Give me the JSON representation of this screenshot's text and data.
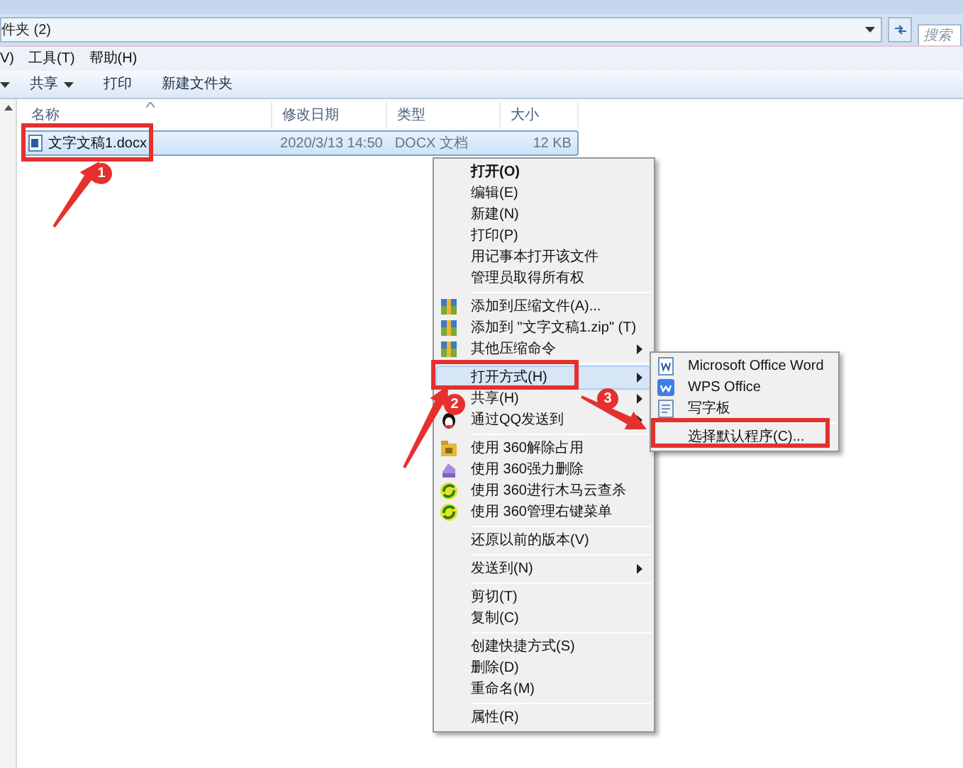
{
  "address_bar": {
    "path": "件夹 (2)",
    "search_placeholder": "搜索"
  },
  "menu_bar": [
    "V)",
    "工具(T)",
    "帮助(H)"
  ],
  "toolbar": [
    {
      "label": "共享",
      "dropdown": true
    },
    {
      "label": "打印",
      "dropdown": false
    },
    {
      "label": "新建文件夹",
      "dropdown": false
    }
  ],
  "columns": [
    {
      "label": "名称",
      "sorted": true
    },
    {
      "label": "修改日期",
      "sorted": false
    },
    {
      "label": "类型",
      "sorted": false
    },
    {
      "label": "大小",
      "sorted": false
    }
  ],
  "files": [
    {
      "name": "文字文稿1.docx",
      "modified": "2020/3/13 14:50",
      "type": "DOCX 文档",
      "size": "12 KB",
      "selected": true
    }
  ],
  "context_menu": {
    "items": [
      {
        "kind": "item",
        "label": "打开(O)",
        "default": true,
        "submenu": false,
        "selected": false
      },
      {
        "kind": "item",
        "label": "编辑(E)",
        "default": false,
        "submenu": false,
        "selected": false
      },
      {
        "kind": "item",
        "label": "新建(N)",
        "default": false,
        "submenu": false,
        "selected": false
      },
      {
        "kind": "item",
        "label": "打印(P)",
        "default": false,
        "submenu": false,
        "selected": false
      },
      {
        "kind": "item",
        "label": "用记事本打开该文件",
        "default": false,
        "submenu": false,
        "selected": false
      },
      {
        "kind": "item",
        "label": "管理员取得所有权",
        "default": false,
        "submenu": false,
        "selected": false
      },
      {
        "kind": "separator"
      },
      {
        "kind": "item",
        "label": "添加到压缩文件(A)...",
        "default": false,
        "submenu": false,
        "selected": false
      },
      {
        "kind": "item",
        "label": "添加到 \"文字文稿1.zip\" (T)",
        "default": false,
        "submenu": false,
        "selected": false
      },
      {
        "kind": "item",
        "label": "其他压缩命令",
        "default": false,
        "submenu": true,
        "selected": false
      },
      {
        "kind": "separator"
      },
      {
        "kind": "item",
        "label": "打开方式(H)",
        "default": false,
        "submenu": true,
        "selected": true
      },
      {
        "kind": "item",
        "label": "共享(H)",
        "default": false,
        "submenu": true,
        "selected": false
      },
      {
        "kind": "item",
        "label": "通过QQ发送到",
        "default": false,
        "submenu": true,
        "selected": false
      },
      {
        "kind": "separator"
      },
      {
        "kind": "item",
        "label": "使用 360解除占用",
        "default": false,
        "submenu": false,
        "selected": false
      },
      {
        "kind": "item",
        "label": "使用 360强力删除",
        "default": false,
        "submenu": false,
        "selected": false
      },
      {
        "kind": "item",
        "label": "使用 360进行木马云查杀",
        "default": false,
        "submenu": false,
        "selected": false
      },
      {
        "kind": "item",
        "label": "使用 360管理右键菜单",
        "default": false,
        "submenu": false,
        "selected": false
      },
      {
        "kind": "separator"
      },
      {
        "kind": "item",
        "label": "还原以前的版本(V)",
        "default": false,
        "submenu": false,
        "selected": false
      },
      {
        "kind": "separator"
      },
      {
        "kind": "item",
        "label": "发送到(N)",
        "default": false,
        "submenu": true,
        "selected": false
      },
      {
        "kind": "separator"
      },
      {
        "kind": "item",
        "label": "剪切(T)",
        "default": false,
        "submenu": false,
        "selected": false
      },
      {
        "kind": "item",
        "label": "复制(C)",
        "default": false,
        "submenu": false,
        "selected": false
      },
      {
        "kind": "separator"
      },
      {
        "kind": "item",
        "label": "创建快捷方式(S)",
        "default": false,
        "submenu": false,
        "selected": false
      },
      {
        "kind": "item",
        "label": "删除(D)",
        "default": false,
        "submenu": false,
        "selected": false
      },
      {
        "kind": "item",
        "label": "重命名(M)",
        "default": false,
        "submenu": false,
        "selected": false
      },
      {
        "kind": "separator"
      },
      {
        "kind": "item",
        "label": "属性(R)",
        "default": false,
        "submenu": false,
        "selected": false
      }
    ]
  },
  "open_with_submenu": {
    "items": [
      {
        "kind": "item",
        "label": "Microsoft Office Word",
        "selected": false
      },
      {
        "kind": "item",
        "label": "WPS Office",
        "selected": false
      },
      {
        "kind": "item",
        "label": "写字板",
        "selected": false
      },
      {
        "kind": "separator"
      },
      {
        "kind": "item",
        "label": "选择默认程序(C)...",
        "selected": false
      }
    ]
  },
  "annotations": [
    {
      "number": "1"
    },
    {
      "number": "2"
    },
    {
      "number": "3"
    }
  ]
}
